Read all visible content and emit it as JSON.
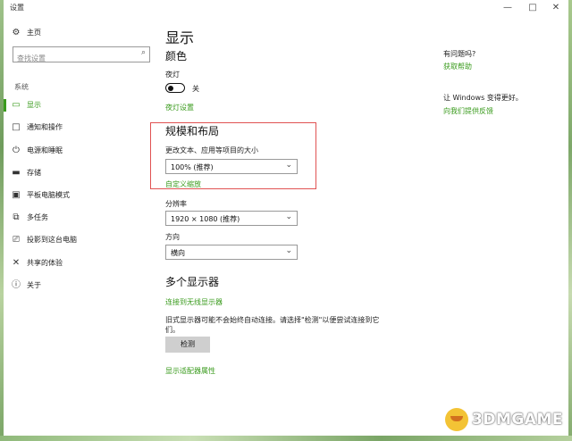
{
  "window": {
    "title": "设置",
    "controls": {
      "minimize": "—",
      "maximize": "□",
      "close": "✕"
    }
  },
  "sidebar": {
    "home": {
      "label": "主页",
      "icon": "gear-icon"
    },
    "search": {
      "placeholder": "查找设置",
      "icon": "search-icon"
    },
    "section": "系统",
    "items": [
      {
        "label": "显示",
        "icon": "monitor-icon",
        "active": true
      },
      {
        "label": "通知和操作",
        "icon": "chat-icon"
      },
      {
        "label": "电源和睡眠",
        "icon": "power-icon"
      },
      {
        "label": "存储",
        "icon": "storage-icon"
      },
      {
        "label": "平板电脑模式",
        "icon": "tablet-icon"
      },
      {
        "label": "多任务",
        "icon": "multitask-icon"
      },
      {
        "label": "投影到这台电脑",
        "icon": "project-icon"
      },
      {
        "label": "共享的体验",
        "icon": "share-icon"
      },
      {
        "label": "关于",
        "icon": "info-icon"
      }
    ]
  },
  "main": {
    "title": "显示",
    "color": {
      "heading": "颜色",
      "night_light_label": "夜灯",
      "night_light_state": "关",
      "night_light_settings_link": "夜灯设置"
    },
    "scale": {
      "heading": "规模和布局",
      "size_label": "更改文本、应用等项目的大小",
      "size_value": "100% (推荐)",
      "custom_link": "自定义缩放",
      "resolution_label": "分辨率",
      "resolution_value": "1920 × 1080 (推荐)",
      "orientation_label": "方向",
      "orientation_value": "横向"
    },
    "multi": {
      "heading": "多个显示器",
      "wireless_link": "连接到无线显示器",
      "desc_line1": "旧式显示器可能不会始终自动连接。请选择\"检测\"以便尝试连接到它",
      "desc_line2": "们。",
      "detect_button": "检测",
      "adapter_link": "显示适配器属性"
    }
  },
  "right": {
    "question": "有问题吗?",
    "help_link": "获取帮助",
    "improve": "让 Windows 变得更好。",
    "feedback_link": "向我们提供反馈"
  },
  "watermark": {
    "text": "3DMGAME"
  }
}
